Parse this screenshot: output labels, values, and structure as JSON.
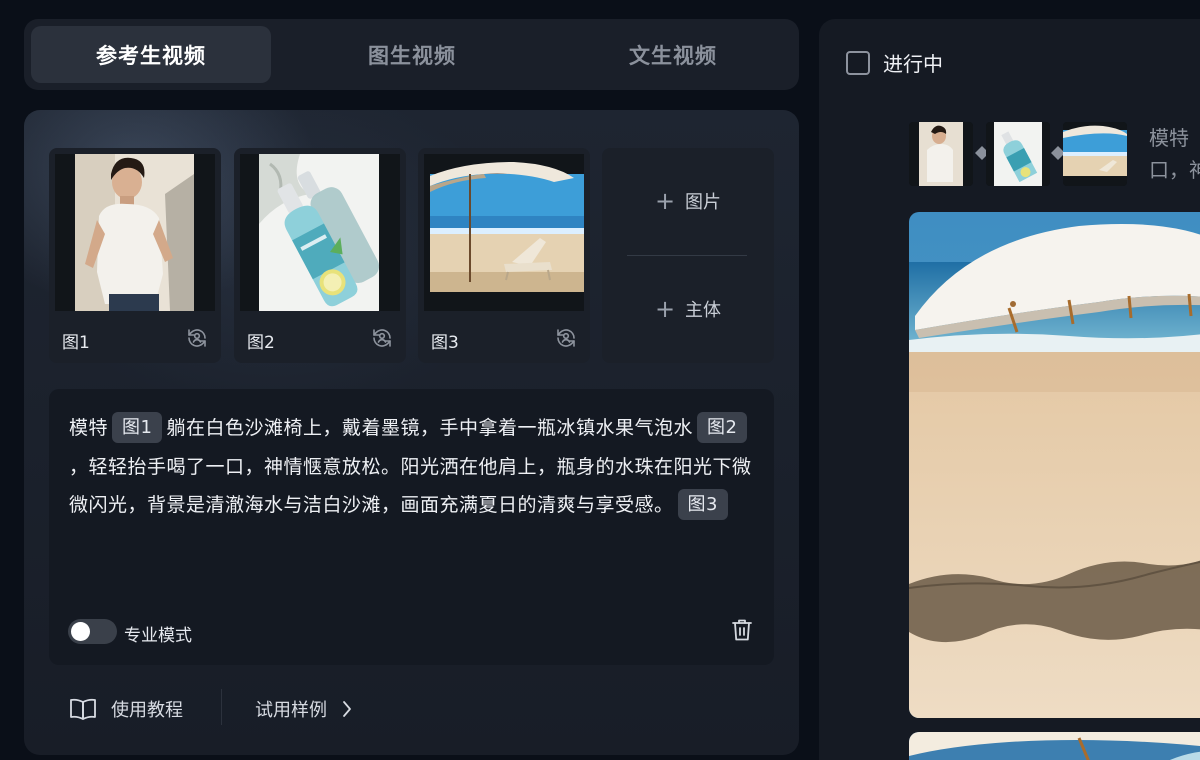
{
  "tabs": [
    {
      "label": "参考生视频",
      "active": true
    },
    {
      "label": "图生视频",
      "active": false
    },
    {
      "label": "文生视频",
      "active": false
    }
  ],
  "references": [
    {
      "caption": "图1",
      "icon": "swap-icon"
    },
    {
      "caption": "图2",
      "icon": "swap-icon"
    },
    {
      "caption": "图3",
      "icon": "swap-icon"
    }
  ],
  "add": {
    "image_label": "图片",
    "subject_label": "主体"
  },
  "prompt": {
    "parts": [
      {
        "type": "text",
        "value": "模特"
      },
      {
        "type": "chip",
        "value": "图1"
      },
      {
        "type": "text",
        "value": "躺在白色沙滩椅上，戴着墨镜，手中拿着一瓶冰镇水果气泡水"
      },
      {
        "type": "chip",
        "value": "图2"
      },
      {
        "type": "text",
        "value": "，轻轻抬手喝了一口，神情惬意放松。阳光洒在他肩上，瓶身的水珠在阳光下微微闪光，背景是清澈海水与洁白沙滩，画面充满夏日的清爽与享受感。"
      },
      {
        "type": "chip",
        "value": "图3"
      }
    ]
  },
  "pro_mode": {
    "label": "专业模式",
    "enabled": false
  },
  "footer": {
    "tutorial": "使用教程",
    "try_examples": "试用样例"
  },
  "right": {
    "in_progress_label": "进行中",
    "preview_text_line1": "模特",
    "preview_text_line2": "口，神"
  },
  "colors": {
    "background": "#0a0f18",
    "panel": "#1b2029",
    "chip": "#3b414c",
    "text": "#eef0f4"
  }
}
